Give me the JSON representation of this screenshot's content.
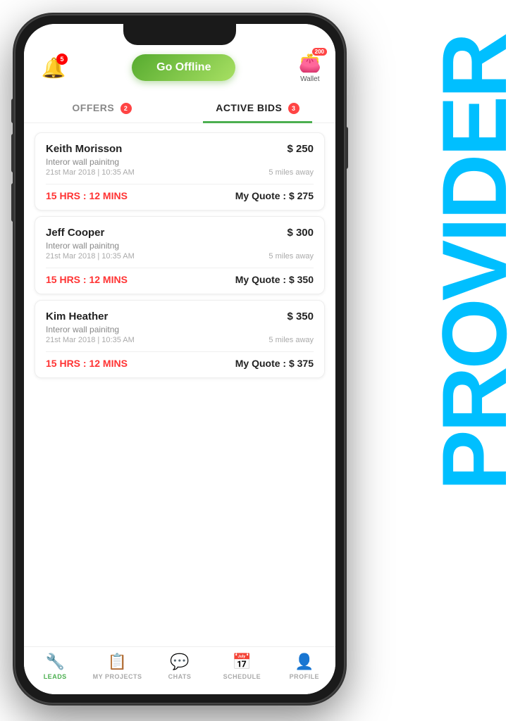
{
  "provider_label": "PROVIDER",
  "header": {
    "bell_badge": "5",
    "go_offline_label": "Go Offline",
    "wallet_badge": "200",
    "wallet_label": "Wallet"
  },
  "tabs": [
    {
      "id": "offers",
      "label": "OFFERS",
      "badge": "2",
      "active": false
    },
    {
      "id": "active_bids",
      "label": "ACTIVE BIDS",
      "badge": "3",
      "active": true
    }
  ],
  "bids": [
    {
      "name": "Keith Morisson",
      "price": "$ 250",
      "service": "Interor wall painitng",
      "datetime": "21st Mar 2018 | 10:35 AM",
      "distance": "5 miles away",
      "timer": "15 HRS : 12 MINS",
      "quote": "My Quote : $ 275"
    },
    {
      "name": "Jeff Cooper",
      "price": "$ 300",
      "service": "Interor wall painitng",
      "datetime": "21st Mar 2018 | 10:35 AM",
      "distance": "5 miles away",
      "timer": "15 HRS : 12 MINS",
      "quote": "My Quote : $ 350"
    },
    {
      "name": "Kim Heather",
      "price": "$ 350",
      "service": "Interor wall painitng",
      "datetime": "21st Mar 2018 | 10:35 AM",
      "distance": "5 miles away",
      "timer": "15 HRS : 12 MINS",
      "quote": "My Quote : $ 375"
    }
  ],
  "bottom_nav": [
    {
      "id": "leads",
      "label": "LEADS",
      "active": true
    },
    {
      "id": "my_projects",
      "label": "MY PROJECTS",
      "active": false
    },
    {
      "id": "chats",
      "label": "CHATS",
      "active": false
    },
    {
      "id": "schedule",
      "label": "SCHEDULE",
      "active": false
    },
    {
      "id": "profile",
      "label": "PROFILE",
      "active": false
    }
  ]
}
